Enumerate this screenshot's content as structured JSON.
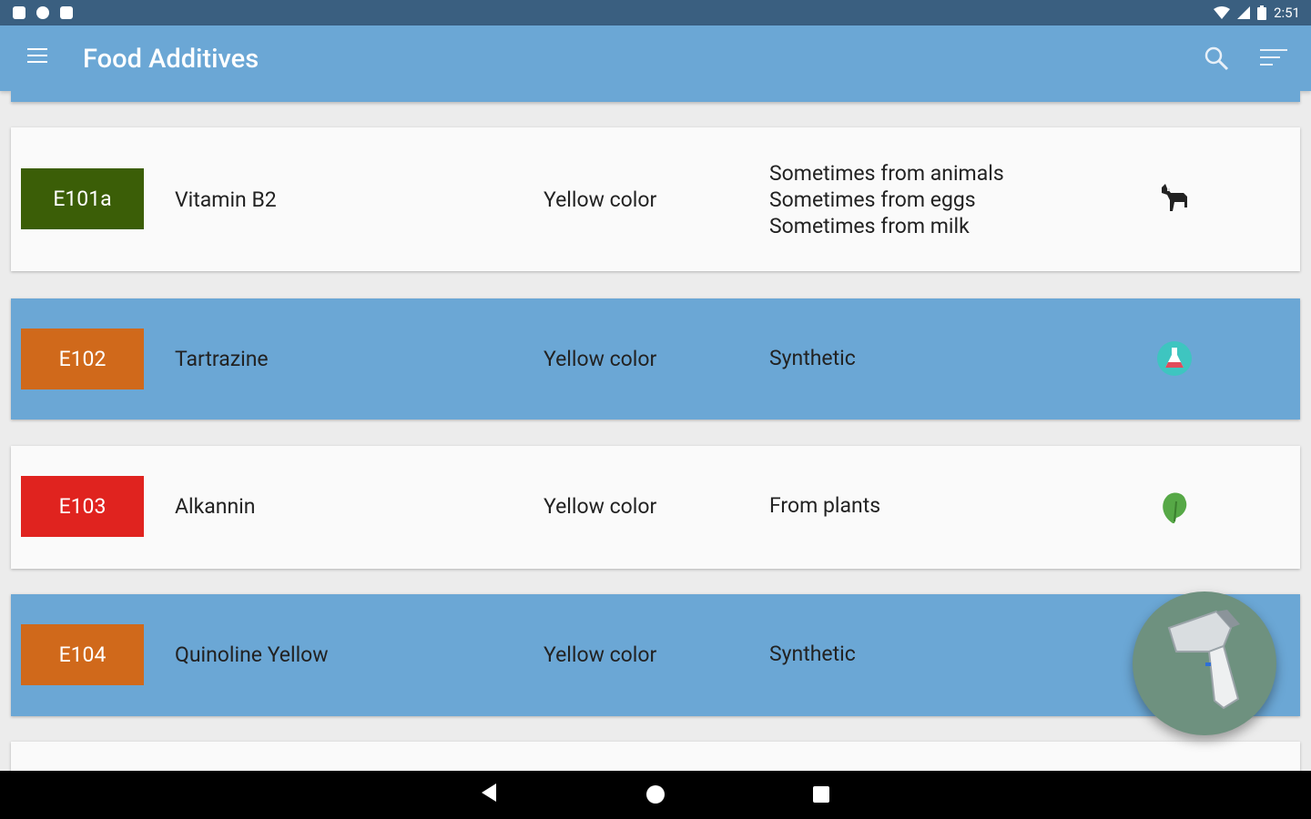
{
  "status_bar": {
    "time": "2:51"
  },
  "app_bar": {
    "title": "Food Additives",
    "menu_icon": "hamburger-menu-icon",
    "search_icon": "search-icon",
    "sort_icon": "sort-icon"
  },
  "additives": [
    {
      "code": "E101a",
      "name": "Vitamin B2",
      "function": "Yellow color",
      "origin_lines": [
        "Sometimes from animals",
        "Sometimes from eggs",
        "Sometimes from milk"
      ],
      "origin_icon": "animal-donkey-icon",
      "badge_color": "#3b5e07",
      "row_style": "white"
    },
    {
      "code": "E102",
      "name": "Tartrazine",
      "function": "Yellow color",
      "origin_lines": [
        "Synthetic"
      ],
      "origin_icon": "flask-icon",
      "badge_color": "#d0691b",
      "row_style": "blue"
    },
    {
      "code": "E103",
      "name": "Alkannin",
      "function": "Yellow color",
      "origin_lines": [
        "From plants"
      ],
      "origin_icon": "leaf-plant-icon",
      "badge_color": "#e0231f",
      "row_style": "white"
    },
    {
      "code": "E104",
      "name": "Quinoline Yellow",
      "function": "Yellow color",
      "origin_lines": [
        "Synthetic"
      ],
      "origin_icon": "flask-icon",
      "badge_color": "#d0691b",
      "row_style": "blue"
    }
  ],
  "fab": {
    "icon": "barcode-scanner-icon"
  },
  "nav_bar": {
    "back_icon": "nav-back-icon",
    "home_icon": "nav-home-icon",
    "recent_icon": "nav-recent-apps-icon"
  }
}
